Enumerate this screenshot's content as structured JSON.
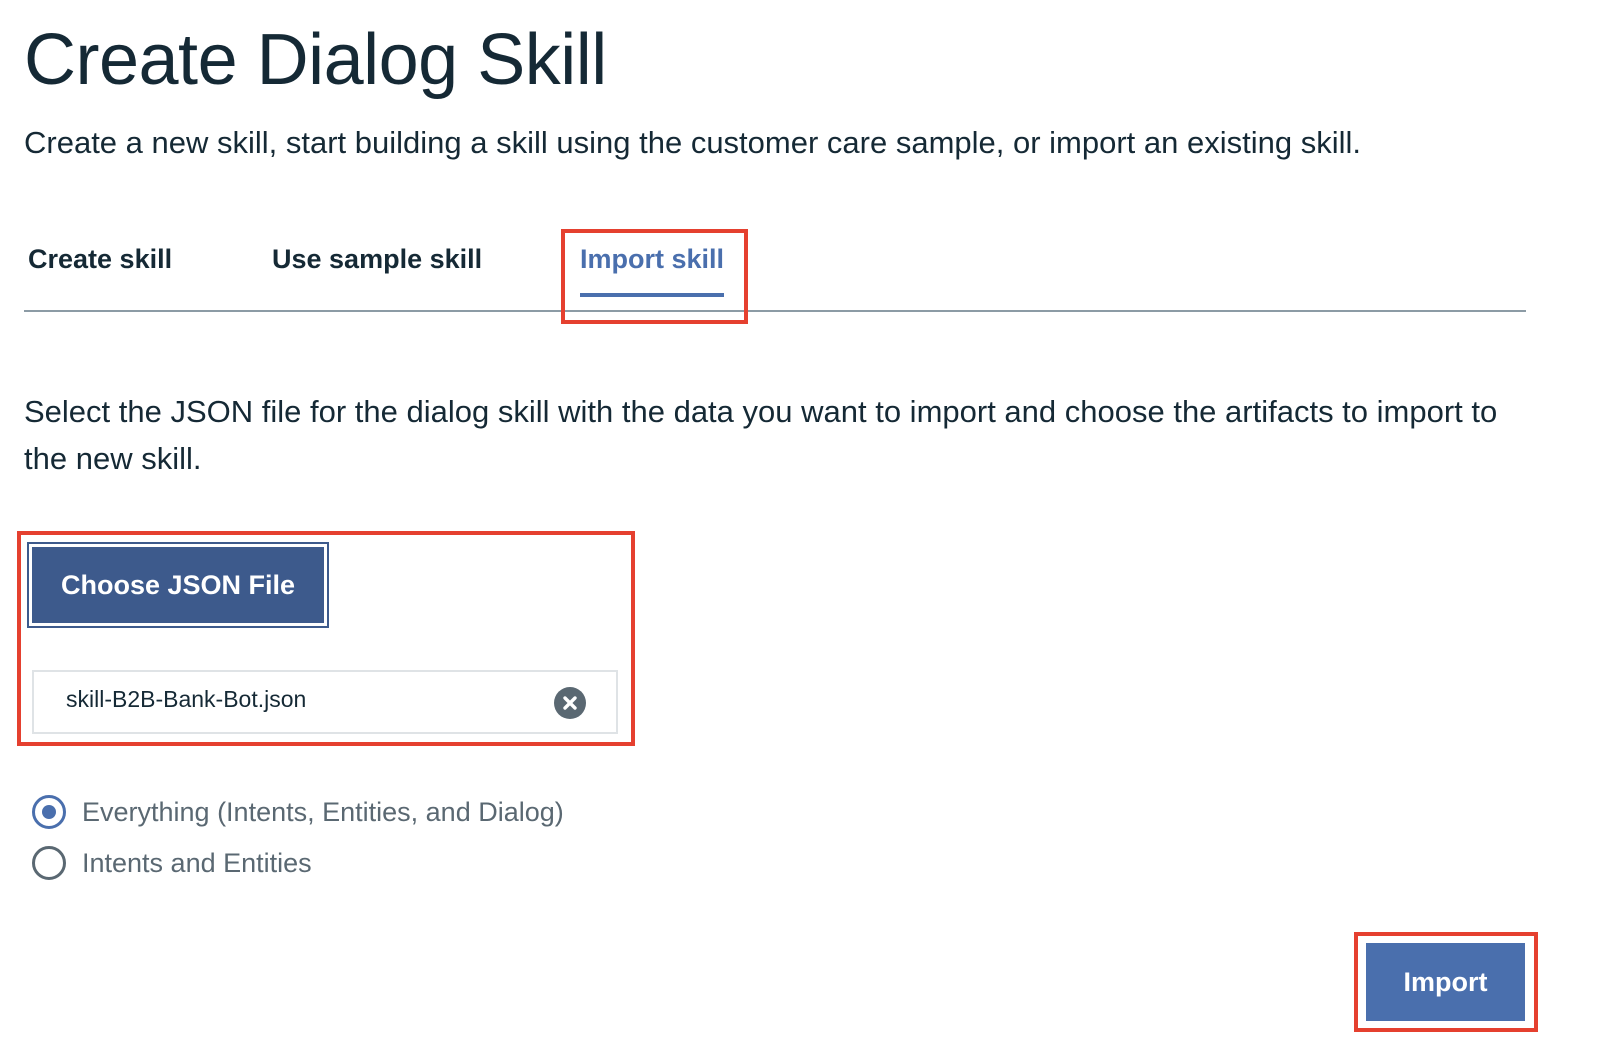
{
  "page": {
    "title": "Create Dialog Skill",
    "subtitle": "Create a new skill, start building a skill using the customer care sample, or import an existing skill."
  },
  "tabs": [
    {
      "label": "Create skill",
      "active": false
    },
    {
      "label": "Use sample skill",
      "active": false
    },
    {
      "label": "Import skill",
      "active": true
    }
  ],
  "import_panel": {
    "instructions": "Select the JSON file for the dialog skill with the data you want to import and choose the artifacts to import to the new skill.",
    "choose_button_label": "Choose JSON File",
    "selected_file": "skill-B2B-Bank-Bot.json",
    "clear_icon": "close-circle-icon"
  },
  "artifact_options": [
    {
      "label": "Everything (Intents, Entities, and Dialog)",
      "selected": true
    },
    {
      "label": "Intents and Entities",
      "selected": false
    }
  ],
  "actions": {
    "import_label": "Import"
  },
  "colors": {
    "accent": "#4a6fad",
    "choose_button": "#3d5a8c",
    "text": "#152935",
    "muted_text": "#5a6872",
    "highlight_box": "#e5402f"
  }
}
